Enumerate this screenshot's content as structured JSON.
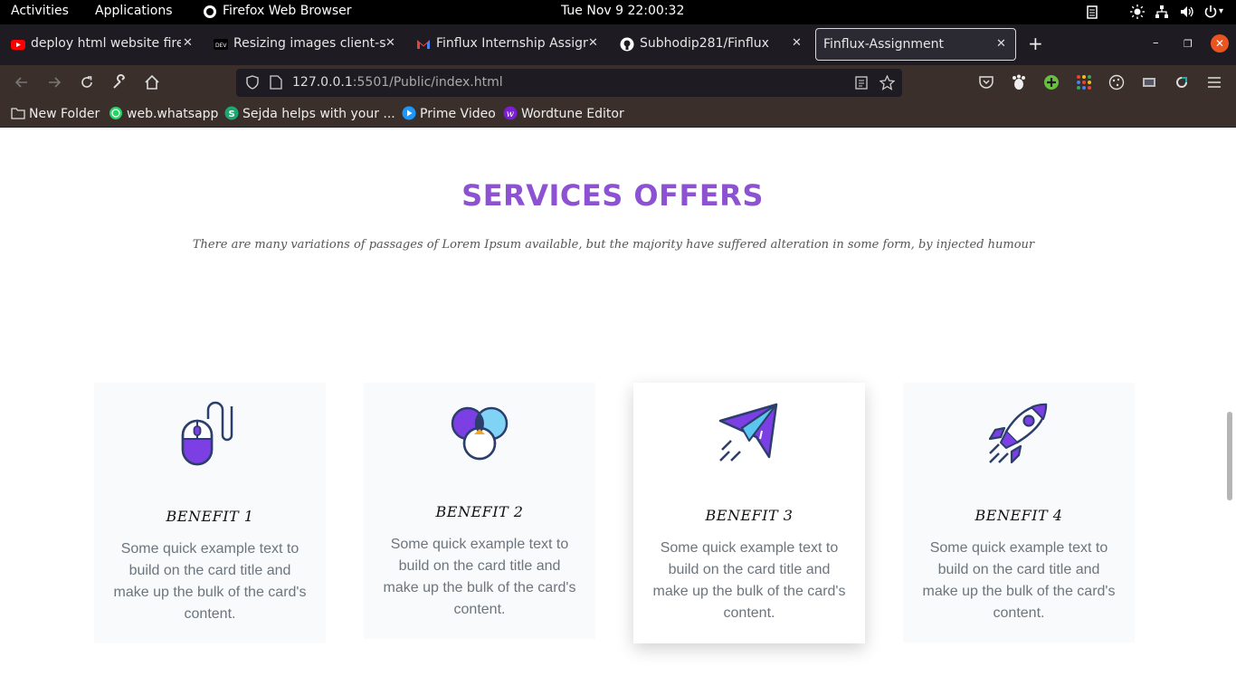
{
  "system": {
    "activities": "Activities",
    "applications": "Applications",
    "app_name": "Firefox Web Browser",
    "clock": "Tue Nov 9  22:00:32"
  },
  "tabs": [
    {
      "title": "deploy html website fireb",
      "icon": "youtube-icon"
    },
    {
      "title": "Resizing images client-sid",
      "icon": "dev-icon"
    },
    {
      "title": "Finflux Internship Assignm",
      "icon": "gmail-icon"
    },
    {
      "title": "Subhodip281/Finflux",
      "icon": "github-icon"
    },
    {
      "title": "Finflux-Assignment",
      "icon": "",
      "active": true
    }
  ],
  "address": {
    "host": "127.0.0.1",
    "rest": ":5501/Public/index.html"
  },
  "bookmarks": [
    {
      "label": "New Folder",
      "icon": "folder-icon"
    },
    {
      "label": "web.whatsapp",
      "icon": "whatsapp-icon"
    },
    {
      "label": "Sejda helps with your ...",
      "icon": "sejda-icon"
    },
    {
      "label": "Prime Video",
      "icon": "prime-video-icon"
    },
    {
      "label": "Wordtune Editor",
      "icon": "wordtune-icon"
    }
  ],
  "section": {
    "title": "SERVICES OFFERS",
    "subtitle": "There are many variations of passages of Lorem Ipsum available, but the majority have suffered alteration in some form, by injected humour"
  },
  "cards": [
    {
      "title": "BENEFIT 1",
      "text": "Some quick example text to build on the card title and make up the bulk of the card's content.",
      "icon": "mouse-icon"
    },
    {
      "title": "BENEFIT 2",
      "text": "Some quick example text to build on the card title and make up the bulk of the card's content.",
      "icon": "color-circles-icon"
    },
    {
      "title": "BENEFIT 3",
      "text": "Some quick example text to build on the card title and make up the bulk of the card's content.",
      "icon": "paper-plane-icon"
    },
    {
      "title": "BENEFIT 4",
      "text": "Some quick example text to build on the card title and make up the bulk of the card's content.",
      "icon": "rocket-icon"
    }
  ],
  "colors": {
    "accent": "#8d52d1",
    "icon_purple": "#7b3fe4",
    "icon_outline": "#2c3e6b"
  }
}
